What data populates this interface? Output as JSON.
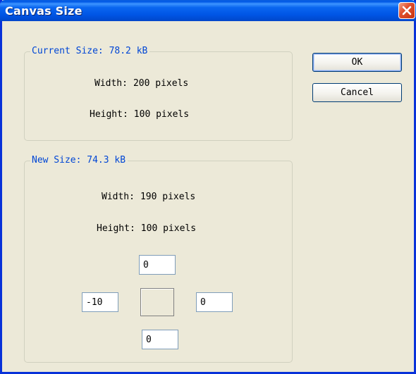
{
  "dialog": {
    "title": "Canvas Size"
  },
  "current_size": {
    "legend": "Current Size: 78.2 kB",
    "width_label": "Width:",
    "width_value": "200 pixels",
    "height_label": "Height:",
    "height_value": "100 pixels"
  },
  "new_size": {
    "legend": "New Size: 74.3 kB",
    "width_label": "Width:",
    "width_value": "190 pixels",
    "height_label": "Height:",
    "height_value": "100 pixels",
    "offsets": {
      "top": "0",
      "left": "-10",
      "right": "0",
      "bottom": "0"
    }
  },
  "buttons": {
    "ok": "OK",
    "cancel": "Cancel"
  },
  "colors": {
    "title_bar": "#0058e6",
    "legend_text": "#0046d5",
    "close_button": "#e0502f",
    "dialog_background": "#ece9d8"
  },
  "icons": {
    "close": "close-icon"
  }
}
